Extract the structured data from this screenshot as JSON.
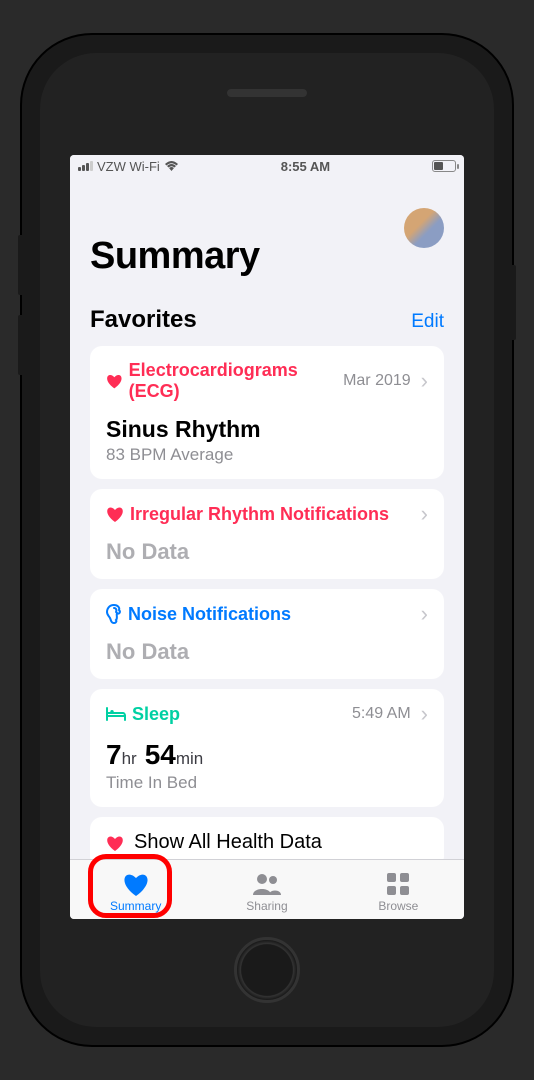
{
  "statusBar": {
    "carrier": "VZW Wi-Fi",
    "time": "8:55 AM"
  },
  "header": {
    "title": "Summary"
  },
  "favorites": {
    "sectionTitle": "Favorites",
    "editLabel": "Edit",
    "cards": [
      {
        "category": "Electrocardiograms (ECG)",
        "timestamp": "Mar 2019",
        "mainValue": "Sinus Rhythm",
        "subValue": "83 BPM Average",
        "iconColor": "#ff2d55",
        "catClass": "cat-heart"
      },
      {
        "category": "Irregular Rhythm Notifications",
        "timestamp": "",
        "noData": "No Data",
        "iconColor": "#ff2d55",
        "catClass": "cat-heart"
      },
      {
        "category": "Noise Notifications",
        "timestamp": "",
        "noData": "No Data",
        "iconColor": "#007aff",
        "catClass": "cat-noise",
        "iconType": "ear"
      },
      {
        "category": "Sleep",
        "timestamp": "5:49 AM",
        "sleepHours": "7",
        "sleepHoursUnit": "hr",
        "sleepMinutes": "54",
        "sleepMinutesUnit": "min",
        "subValue": "Time In Bed",
        "iconColor": "#00d0a3",
        "catClass": "cat-sleep",
        "iconType": "bed"
      }
    ],
    "showAll": "Show All Health Data"
  },
  "tabBar": {
    "items": [
      {
        "label": "Summary",
        "active": true
      },
      {
        "label": "Sharing",
        "active": false
      },
      {
        "label": "Browse",
        "active": false
      }
    ]
  }
}
